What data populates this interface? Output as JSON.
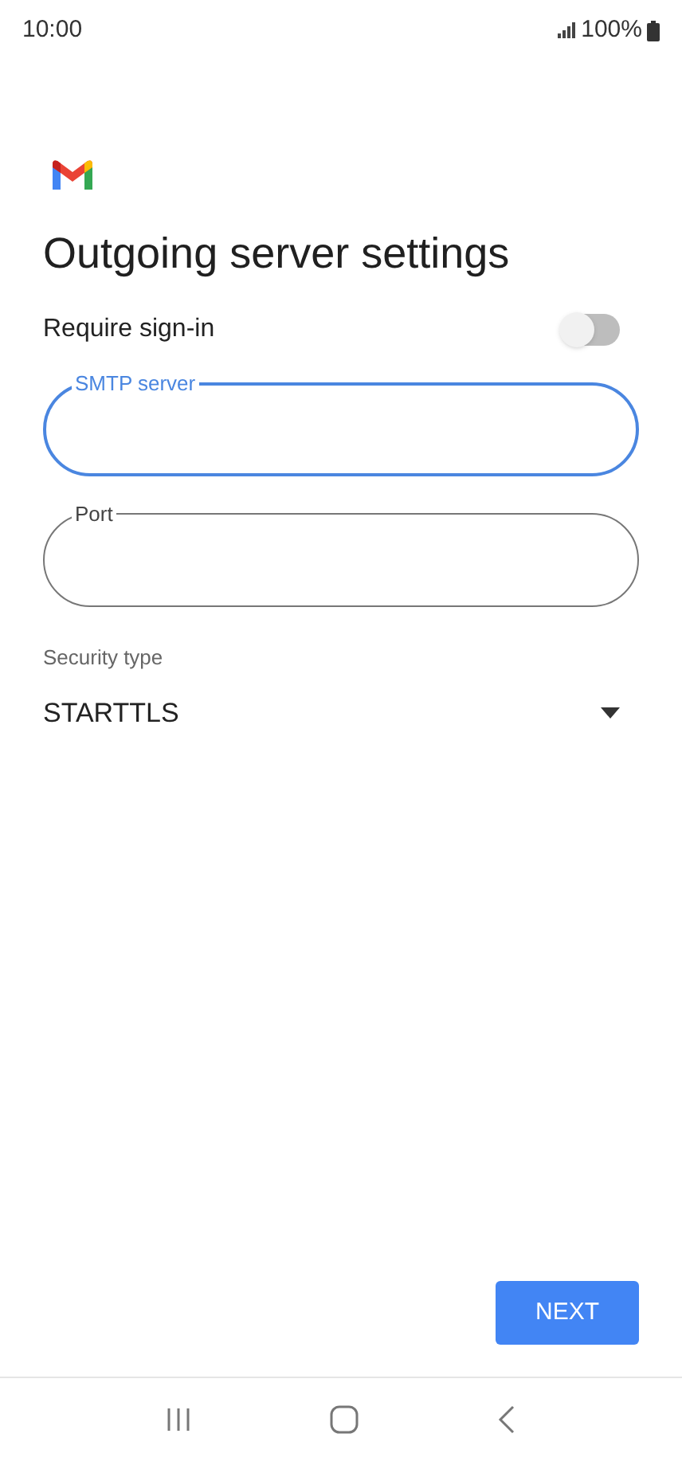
{
  "status_bar": {
    "time": "10:00",
    "battery": "100%"
  },
  "title": "Outgoing server settings",
  "require_sign_in": {
    "label": "Require sign-in",
    "on": false
  },
  "fields": [
    {
      "label": "SMTP server",
      "focused": true
    },
    {
      "label": "Port",
      "focused": false
    }
  ],
  "security_type": {
    "label": "Security type",
    "value": "STARTTLS"
  },
  "next_button": "NEXT"
}
